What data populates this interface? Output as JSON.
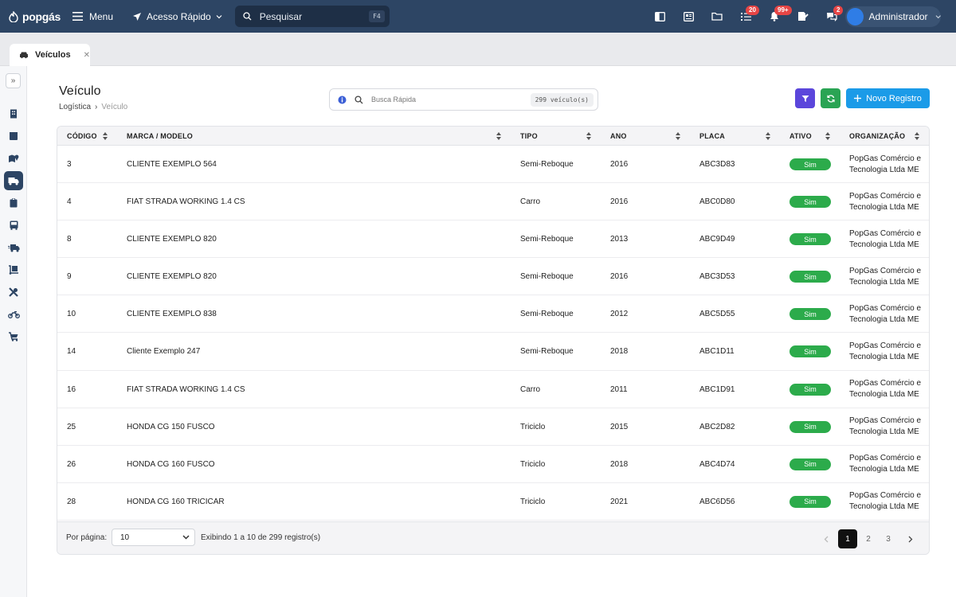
{
  "topbar": {
    "logo_text": "popgás",
    "menu_label": "Menu",
    "quick_access_label": "Acesso Rápido",
    "search_placeholder": "Pesquisar",
    "search_shortcut": "F4",
    "badges": {
      "tasks": "20",
      "notifications": "99+",
      "chat": "2"
    },
    "user_name": "Administrador",
    "bg_color": "#2d4564"
  },
  "tabs": [
    {
      "label": "Veículos"
    }
  ],
  "page": {
    "title": "Veículo",
    "breadcrumb": {
      "parent": "Logística",
      "separator": "›",
      "current": "Veículo"
    },
    "quick_search_placeholder": "Busca Rápida",
    "record_count": "299 veículo(s)",
    "new_button_label": "Novo Registro"
  },
  "table": {
    "columns": [
      "CÓDIGO",
      "MARCA / MODELO",
      "TIPO",
      "ANO",
      "PLACA",
      "ATIVO",
      "ORGANIZAÇÃO"
    ],
    "rows": [
      {
        "codigo": "3",
        "modelo": "CLIENTE EXEMPLO 564",
        "tipo": "Semi-Reboque",
        "ano": "2016",
        "placa": "ABC3D83",
        "ativo": "Sim",
        "org1": "PopGas Comércio e",
        "org2": "Tecnologia Ltda ME"
      },
      {
        "codigo": "4",
        "modelo": "FIAT STRADA WORKING 1.4 CS",
        "tipo": "Carro",
        "ano": "2016",
        "placa": "ABC0D80",
        "ativo": "Sim",
        "org1": "PopGas Comércio e",
        "org2": "Tecnologia Ltda ME"
      },
      {
        "codigo": "8",
        "modelo": "CLIENTE EXEMPLO 820",
        "tipo": "Semi-Reboque",
        "ano": "2013",
        "placa": "ABC9D49",
        "ativo": "Sim",
        "org1": "PopGas Comércio e",
        "org2": "Tecnologia Ltda ME"
      },
      {
        "codigo": "9",
        "modelo": "CLIENTE EXEMPLO 820",
        "tipo": "Semi-Reboque",
        "ano": "2016",
        "placa": "ABC3D53",
        "ativo": "Sim",
        "org1": "PopGas Comércio e",
        "org2": "Tecnologia Ltda ME"
      },
      {
        "codigo": "10",
        "modelo": "CLIENTE EXEMPLO 838",
        "tipo": "Semi-Reboque",
        "ano": "2012",
        "placa": "ABC5D55",
        "ativo": "Sim",
        "org1": "PopGas Comércio e",
        "org2": "Tecnologia Ltda ME"
      },
      {
        "codigo": "14",
        "modelo": "Cliente Exemplo 247",
        "tipo": "Semi-Reboque",
        "ano": "2018",
        "placa": "ABC1D11",
        "ativo": "Sim",
        "org1": "PopGas Comércio e",
        "org2": "Tecnologia Ltda ME"
      },
      {
        "codigo": "16",
        "modelo": "FIAT STRADA WORKING 1.4 CS",
        "tipo": "Carro",
        "ano": "2011",
        "placa": "ABC1D91",
        "ativo": "Sim",
        "org1": "PopGas Comércio e",
        "org2": "Tecnologia Ltda ME"
      },
      {
        "codigo": "25",
        "modelo": "HONDA CG 150 FUSCO",
        "tipo": "Triciclo",
        "ano": "2015",
        "placa": "ABC2D82",
        "ativo": "Sim",
        "org1": "PopGas Comércio e",
        "org2": "Tecnologia Ltda ME"
      },
      {
        "codigo": "26",
        "modelo": "HONDA CG 160 FUSCO",
        "tipo": "Triciclo",
        "ano": "2018",
        "placa": "ABC4D74",
        "ativo": "Sim",
        "org1": "PopGas Comércio e",
        "org2": "Tecnologia Ltda ME"
      },
      {
        "codigo": "28",
        "modelo": "HONDA CG 160 TRICICAR",
        "tipo": "Triciclo",
        "ano": "2021",
        "placa": "ABC6D56",
        "ativo": "Sim",
        "org1": "PopGas Comércio e",
        "org2": "Tecnologia Ltda ME"
      }
    ],
    "active_color": "#2cab4b"
  },
  "footer": {
    "per_page_label": "Por página:",
    "per_page_value": "10",
    "showing_text": "Exibindo 1 a 10 de 299 registro(s)",
    "pages": [
      "1",
      "2",
      "3"
    ]
  },
  "icons": {
    "sidebar": [
      "building-icon",
      "box-icon",
      "map-pin-icon",
      "truck-icon",
      "clipboard-icon",
      "bus-icon",
      "delivery-truck-icon",
      "hand-truck-icon",
      "tools-icon",
      "motorcycle-icon",
      "cart-icon"
    ]
  }
}
